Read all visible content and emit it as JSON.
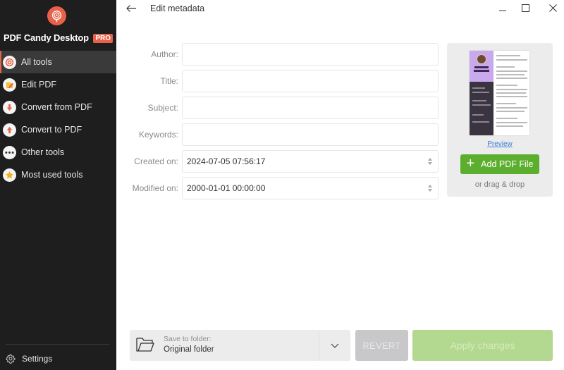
{
  "app": {
    "name": "PDF Candy Desktop",
    "badge": "PRO",
    "brand_color": "#e8614a"
  },
  "sidebar": {
    "items": [
      {
        "label": "All tools",
        "icon": "swirl-icon",
        "active": true
      },
      {
        "label": "Edit PDF",
        "icon": "edit-pencil-icon",
        "active": false
      },
      {
        "label": "Convert from PDF",
        "icon": "arrow-down-icon",
        "active": false
      },
      {
        "label": "Convert to PDF",
        "icon": "arrow-up-icon",
        "active": false
      },
      {
        "label": "Other tools",
        "icon": "more-dots-icon",
        "active": false
      },
      {
        "label": "Most used tools",
        "icon": "star-icon",
        "active": false
      }
    ],
    "settings_label": "Settings"
  },
  "header": {
    "title": "Edit metadata"
  },
  "form": {
    "fields": [
      {
        "label": "Author:",
        "value": "",
        "type": "text"
      },
      {
        "label": "Title:",
        "value": "",
        "type": "text"
      },
      {
        "label": "Subject:",
        "value": "",
        "type": "text"
      },
      {
        "label": "Keywords:",
        "value": "",
        "type": "text"
      },
      {
        "label": "Created on:",
        "value": "2024-07-05 07:56:17",
        "type": "datetime"
      },
      {
        "label": "Modified on:",
        "value": "2000-01-01 00:00:00",
        "type": "datetime"
      }
    ]
  },
  "preview_panel": {
    "preview_label": "Preview",
    "add_button_label": "Add PDF File",
    "drag_hint": "or drag & drop",
    "add_button_color": "#5cae2e"
  },
  "footer": {
    "save_folder_label": "Save to folder:",
    "save_folder_value": "Original folder",
    "revert_label": "REVERT",
    "apply_label": "Apply changes"
  }
}
